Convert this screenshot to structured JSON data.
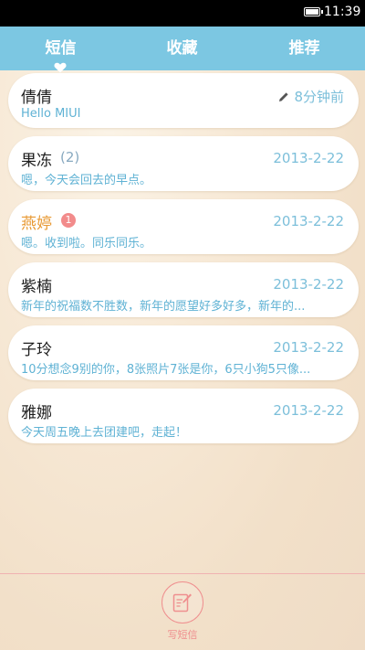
{
  "status_bar": {
    "time": "11:39",
    "battery_icon": "battery-icon"
  },
  "tabs": [
    {
      "label": "短信",
      "active": true
    },
    {
      "label": "收藏",
      "active": false
    },
    {
      "label": "推荐",
      "active": false
    }
  ],
  "messages": [
    {
      "name": "倩倩",
      "count": "",
      "unread": "",
      "time": "8分钟前",
      "draft": true,
      "preview": "Hello MIUI",
      "highlight": false
    },
    {
      "name": "果冻",
      "count": "(2)",
      "unread": "",
      "time": "2013-2-22",
      "draft": false,
      "preview": "嗯，今天会回去的早点。",
      "highlight": false
    },
    {
      "name": "燕婷",
      "count": "",
      "unread": "1",
      "time": "2013-2-22",
      "draft": false,
      "preview": "嗯。收到啦。同乐同乐。",
      "highlight": true
    },
    {
      "name": "紫楠",
      "count": "",
      "unread": "",
      "time": "2013-2-22",
      "draft": false,
      "preview": "新年的祝福数不胜数，新年的愿望好多好多，新年的...",
      "highlight": false
    },
    {
      "name": "子玲",
      "count": "",
      "unread": "",
      "time": "2013-2-22",
      "draft": false,
      "preview": "10分想念9别的你，8张照片7张是你，6只小狗5只像...",
      "highlight": false
    },
    {
      "name": "雅娜",
      "count": "",
      "unread": "",
      "time": "2013-2-22",
      "draft": false,
      "preview": "今天周五晚上去团建吧，走起！",
      "highlight": false
    }
  ],
  "compose": {
    "label": "写短信",
    "icon": "compose-icon"
  },
  "colors": {
    "tab_bar": "#7cc7e2",
    "accent_blue": "#5fb2d4",
    "highlight_orange": "#e89a35",
    "badge_red": "#f28b8b",
    "compose_pink": "#ef8f8f"
  }
}
